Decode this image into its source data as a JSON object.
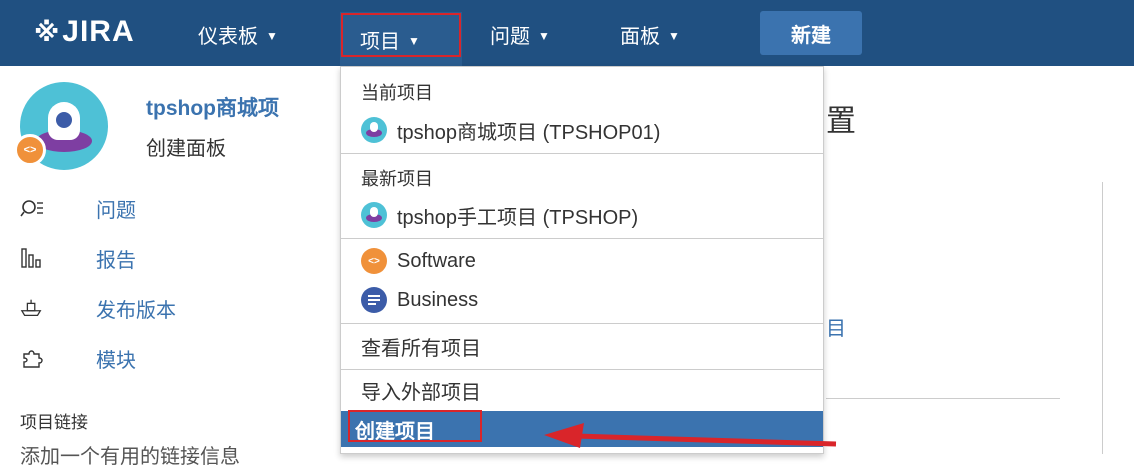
{
  "nav": {
    "logo_text": "JIRA",
    "dashboards_label": "仪表板",
    "projects_label": "项目",
    "issues_label": "问题",
    "boards_label": "面板",
    "create_label": "新建"
  },
  "project": {
    "name": "tpshop商城项",
    "subtitle": "创建面板",
    "type_badge": "<>"
  },
  "sidebar": {
    "items": [
      {
        "label": "问题",
        "icon": "search-list-icon"
      },
      {
        "label": "报告",
        "icon": "chart-icon"
      },
      {
        "label": "发布版本",
        "icon": "ship-icon"
      },
      {
        "label": "模块",
        "icon": "puzzle-icon"
      }
    ],
    "links_heading": "项目链接",
    "links_text_cut": "添加一个有用的链接信息"
  },
  "background": {
    "title_fragment": "置",
    "link_fragment": "目"
  },
  "dropdown": {
    "current_heading": "当前项目",
    "current_project": "tpshop商城项目 (TPSHOP01)",
    "recent_heading": "最新项目",
    "recent_project": "tpshop手工项目 (TPSHOP)",
    "type_software": "Software",
    "type_business": "Business",
    "view_all": "查看所有项目",
    "import": "导入外部项目",
    "create": "创建项目"
  },
  "colors": {
    "nav_bg": "#205081",
    "accent": "#3b73af",
    "highlight_box": "#d9252a",
    "arrow": "#d9252a"
  }
}
